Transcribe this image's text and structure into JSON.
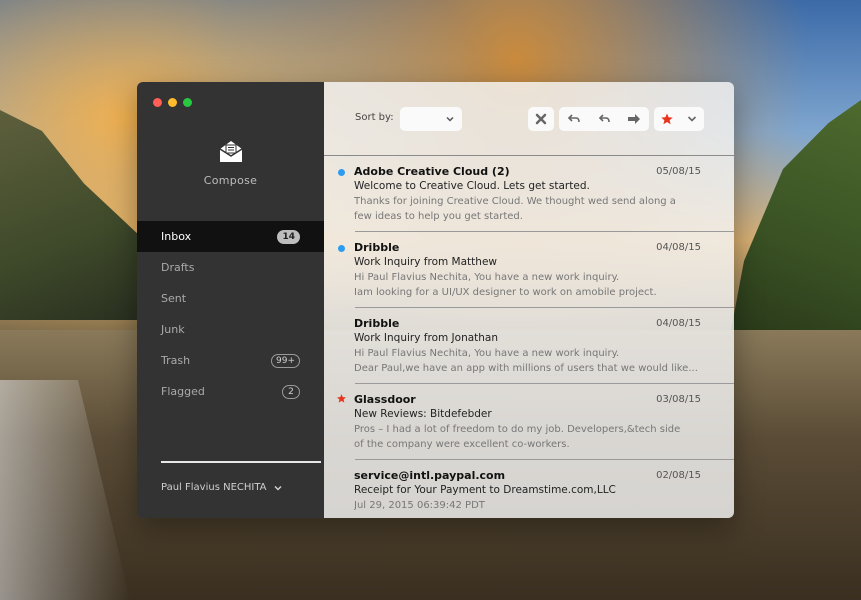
{
  "sidebar": {
    "compose_label": "Compose",
    "items": [
      {
        "label": "Inbox",
        "badge": "14",
        "active": true
      },
      {
        "label": "Drafts",
        "badge": ""
      },
      {
        "label": "Sent",
        "badge": ""
      },
      {
        "label": "Junk",
        "badge": ""
      },
      {
        "label": "Trash",
        "badge": "99+"
      },
      {
        "label": "Flagged",
        "badge": "2"
      }
    ],
    "account": "Paul Flavius NECHITA"
  },
  "toolbar": {
    "sort_label": "Sort by:",
    "sort_value": ""
  },
  "colors": {
    "unread_dot": "#2d9cf0",
    "flag_star": "#e8341c",
    "sidebar_bg": "#333333"
  },
  "mails": [
    {
      "sender": "Adobe Creative Cloud (2)",
      "date": "05/08/15",
      "subject": "Welcome to Creative Cloud. Lets get started.",
      "preview1": "Thanks for joining Creative Cloud. We thought wed send along a",
      "preview2": "few ideas to help you get started.",
      "marker": "unread-dot"
    },
    {
      "sender": "Dribble",
      "date": "04/08/15",
      "subject": "Work Inquiry from Matthew",
      "preview1": "Hi Paul Flavius Nechita, You have a new work inquiry.",
      "preview2": "Iam looking for a UI/UX designer to work on amobile project.",
      "marker": "unread-dot"
    },
    {
      "sender": "Dribble",
      "date": "04/08/15",
      "subject": "Work Inquiry from Jonathan",
      "preview1": "Hi Paul Flavius Nechita, You have a new work inquiry.",
      "preview2": "Dear Paul,we have an app with millions of users that we would like...",
      "marker": ""
    },
    {
      "sender": "Glassdoor",
      "date": "03/08/15",
      "subject": "New Reviews: Bitdefebder",
      "preview1": "Pros – I had a lot of freedom to do my job. Developers,&tech side",
      "preview2": "of the company were excellent co-workers.",
      "marker": "flag-star"
    },
    {
      "sender": "service@intl.paypal.com",
      "date": "02/08/15",
      "subject": "Receipt for Your Payment to Dreamstime.com,LLC",
      "preview1": "Jul 29, 2015 06:39:42 PDT",
      "preview2": "",
      "marker": ""
    }
  ]
}
